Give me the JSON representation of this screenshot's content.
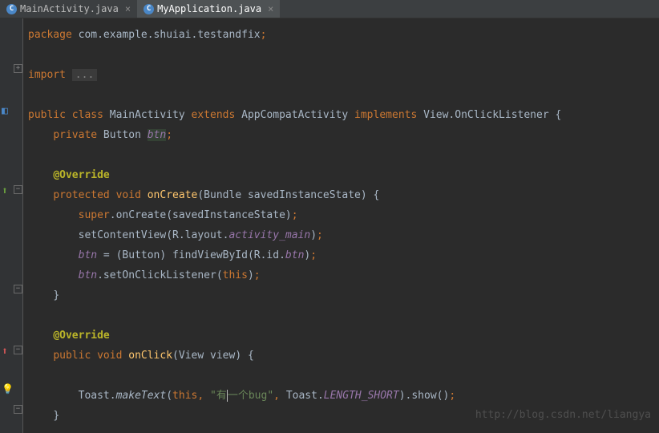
{
  "tabs": [
    {
      "label": "MainActivity.java",
      "icon": "C",
      "active": false
    },
    {
      "label": "MyApplication.java",
      "icon": "C",
      "active": true
    }
  ],
  "code": {
    "package_kw": "package",
    "package_name": " com.example.shuiai.testandfix",
    "import_kw": "import ",
    "import_fold": "...",
    "class_public": "public ",
    "class_kw": "class ",
    "class_name": "MainActivity ",
    "extends_kw": "extends ",
    "super_class": "AppCompatActivity ",
    "implements_kw": "implements ",
    "interface": "View.OnClickListener ",
    "brace_open": "{",
    "private_kw": "private",
    "button_type": " Button ",
    "btn_field": "btn",
    "override": "@Override",
    "protected_kw": "protected ",
    "void_kw": "void ",
    "oncreate": "onCreate",
    "oncreate_params": "(Bundle savedInstanceState) {",
    "super_kw": "super",
    "super_call": ".onCreate(savedInstanceState)",
    "setcontent": "setContentView(R.layout.",
    "activity_main": "activity_main",
    "close_paren": ")",
    "btn_assign1": "btn",
    "btn_assign2": " = (Button) findViewById(R.id.",
    "btn_id": "btn",
    "btn_listener1": "btn",
    "btn_listener2": ".setOnClickListener(",
    "this_kw": "this",
    "close_brace": "}",
    "public_kw": "public ",
    "onclick": "onClick",
    "onclick_params": "(View view) {",
    "toast": "Toast.",
    "maketext": "makeText",
    "toast_open": "(",
    "toast_str": "\"有一个bug\"",
    "toast_comma": ", ",
    "toast2": "Toast.",
    "length_short": "LENGTH_SHORT",
    "show_call": ").show()"
  },
  "watermark": "http://blog.csdn.net/liangya"
}
